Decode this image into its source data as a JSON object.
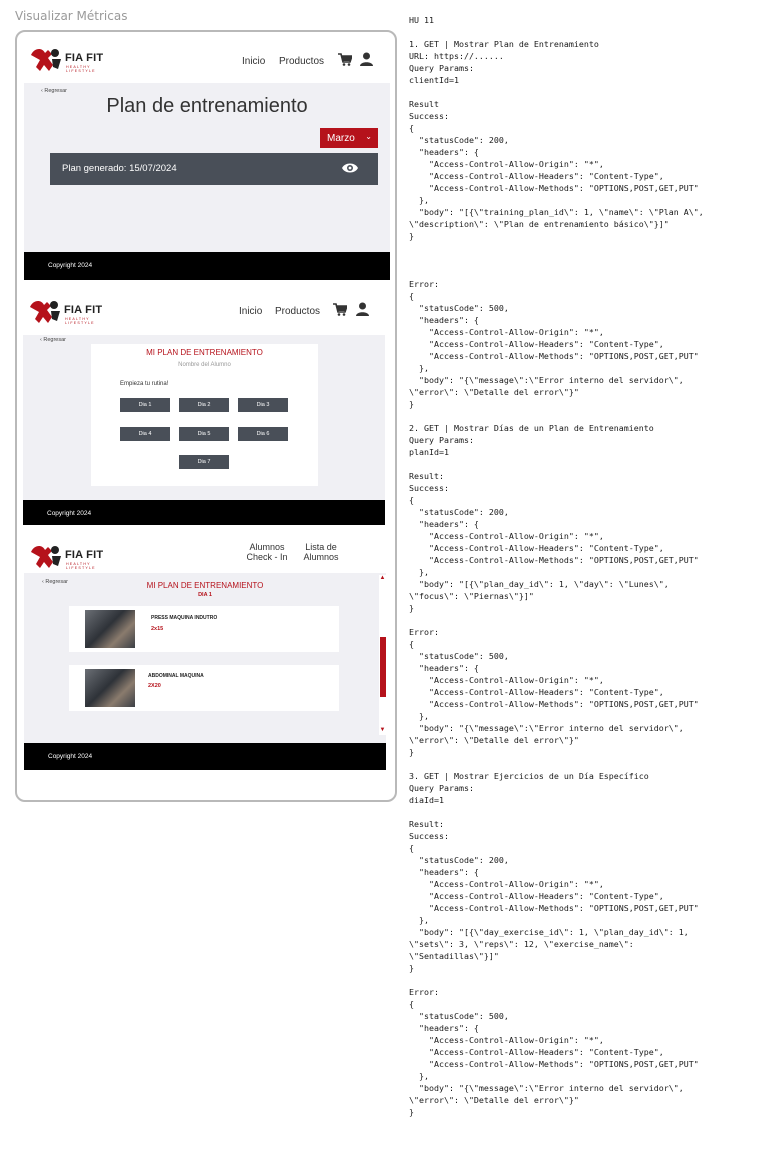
{
  "frame": {
    "title": "Visualizar Métricas"
  },
  "brand": {
    "name": "FIA FIT",
    "tagline": "HEALTHY LIFESTYLE"
  },
  "nav": {
    "home": "Inicio",
    "products": "Productos",
    "students_checkin": "Alumnos Check - In",
    "students_list": "Lista de Alumnos"
  },
  "common": {
    "back": "Regresar",
    "copyright": "Copyright 2024"
  },
  "screen1": {
    "title": "Plan de entrenamiento",
    "month": "Marzo",
    "plan_generated": "Plan generado: 15/07/2024"
  },
  "screen2": {
    "title": "MI PLAN DE ENTRENAMIENTO",
    "student_name": "Nombre del Alumno",
    "start_label": "Empieza tu rutina!",
    "days": [
      "Dia 1",
      "Dia 2",
      "Dia 3",
      "Dia 4",
      "Dia 5",
      "Dia 6",
      "Dia 7"
    ]
  },
  "screen3": {
    "title": "MI PLAN DE ENTRENAMIENTO",
    "day": "DIA 1",
    "exercises": [
      {
        "name": "PRESS MAQUINA INDUTRO",
        "sets": "2x15"
      },
      {
        "name": "ABDOMINAL MAQUINA",
        "sets": "2X20"
      }
    ]
  },
  "code_text": "HU 11\n\n1. GET | Mostrar Plan de Entrenamiento\nURL: https://......\nQuery Params:\nclientId=1\n\nResult\nSuccess:\n{\n  \"statusCode\": 200,\n  \"headers\": {\n    \"Access-Control-Allow-Origin\": \"*\",\n    \"Access-Control-Allow-Headers\": \"Content-Type\",\n    \"Access-Control-Allow-Methods\": \"OPTIONS,POST,GET,PUT\"\n  },\n  \"body\": \"[{\\\"training_plan_id\\\": 1, \\\"name\\\": \\\"Plan A\\\",\n\\\"description\\\": \\\"Plan de entrenamiento básico\\\"}]\"\n}\n\n\n\nError:\n{\n  \"statusCode\": 500,\n  \"headers\": {\n    \"Access-Control-Allow-Origin\": \"*\",\n    \"Access-Control-Allow-Headers\": \"Content-Type\",\n    \"Access-Control-Allow-Methods\": \"OPTIONS,POST,GET,PUT\"\n  },\n  \"body\": \"{\\\"message\\\":\\\"Error interno del servidor\\\",\n\\\"error\\\": \\\"Detalle del error\\\"}\"\n}\n\n2. GET | Mostrar Días de un Plan de Entrenamiento\nQuery Params:\nplanId=1\n\nResult:\nSuccess:\n{\n  \"statusCode\": 200,\n  \"headers\": {\n    \"Access-Control-Allow-Origin\": \"*\",\n    \"Access-Control-Allow-Headers\": \"Content-Type\",\n    \"Access-Control-Allow-Methods\": \"OPTIONS,POST,GET,PUT\"\n  },\n  \"body\": \"[{\\\"plan_day_id\\\": 1, \\\"day\\\": \\\"Lunes\\\",\n\\\"focus\\\": \\\"Piernas\\\"}]\"\n}\n\nError:\n{\n  \"statusCode\": 500,\n  \"headers\": {\n    \"Access-Control-Allow-Origin\": \"*\",\n    \"Access-Control-Allow-Headers\": \"Content-Type\",\n    \"Access-Control-Allow-Methods\": \"OPTIONS,POST,GET,PUT\"\n  },\n  \"body\": \"{\\\"message\\\":\\\"Error interno del servidor\\\",\n\\\"error\\\": \\\"Detalle del error\\\"}\"\n}\n\n3. GET | Mostrar Ejercicios de un Día Específico\nQuery Params:\ndiaId=1\n\nResult:\nSuccess:\n{\n  \"statusCode\": 200,\n  \"headers\": {\n    \"Access-Control-Allow-Origin\": \"*\",\n    \"Access-Control-Allow-Headers\": \"Content-Type\",\n    \"Access-Control-Allow-Methods\": \"OPTIONS,POST,GET,PUT\"\n  },\n  \"body\": \"[{\\\"day_exercise_id\\\": 1, \\\"plan_day_id\\\": 1,\n\\\"sets\\\": 3, \\\"reps\\\": 12, \\\"exercise_name\\\":\n\\\"Sentadillas\\\"}]\"\n}\n\nError:\n{\n  \"statusCode\": 500,\n  \"headers\": {\n    \"Access-Control-Allow-Origin\": \"*\",\n    \"Access-Control-Allow-Headers\": \"Content-Type\",\n    \"Access-Control-Allow-Methods\": \"OPTIONS,POST,GET,PUT\"\n  },\n  \"body\": \"{\\\"message\\\":\\\"Error interno del servidor\\\",\n\\\"error\\\": \\\"Detalle del error\\\"}\"\n}",
  "colors": {
    "accent": "#b5121b",
    "dark": "#494f58",
    "footer": "#000000",
    "bg": "#f0f0f4"
  },
  "icons": [
    "logo-mark-icon",
    "cart-icon",
    "user-icon",
    "eye-icon",
    "chevron-down-icon",
    "chevron-left-icon",
    "arrow-up-icon",
    "arrow-down-icon"
  ]
}
